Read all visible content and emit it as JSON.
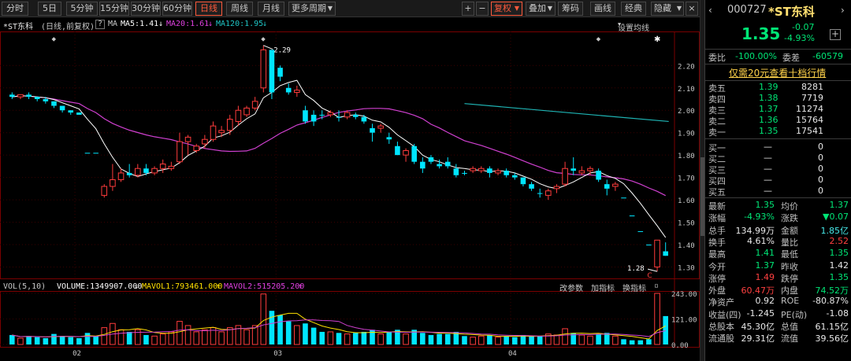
{
  "toolbar": {
    "tabs": [
      "分时",
      "5日",
      "5分钟",
      "15分钟",
      "30分钟",
      "60分钟",
      "日线",
      "周线",
      "月线",
      "更多周期"
    ],
    "active_tab": "日线",
    "plus": "+",
    "minus": "−",
    "fuquan": "复权",
    "diejia": "叠加",
    "chouma": "筹码",
    "huaxian": "画线",
    "jingdian": "经典",
    "yincang": "隐藏",
    "close": "×"
  },
  "infobar": {
    "name": "*ST东科",
    "mode": "(日线,前复权)",
    "help": "?",
    "ma5": "MA5:1.41",
    "ma20": "MA20:1.61",
    "ma120": "MA120:1.95",
    "arrow_down": "↓",
    "settings": "设置均线"
  },
  "volinfo": {
    "label": "VOL(5,10)",
    "volume": "VOLUME:1349907.000",
    "mavol1": "MAVOL1:793461.000",
    "mavol2": "MAVOL2:515205.200",
    "arrow_down": "↓",
    "arrow_up": "↑",
    "btn1": "改参数",
    "btn2": "加指标",
    "btn3": "换指标"
  },
  "right": {
    "code": "000727",
    "name": "*ST东科",
    "price": "1.35",
    "change": "-0.07",
    "change_pct": "-4.93%",
    "weibi_label": "委比",
    "weibi": "-100.00%",
    "weicha_label": "委差",
    "weicha": "-60579",
    "link": "仅需20元查看十档行情",
    "sell": [
      {
        "label": "卖五",
        "price": "1.39",
        "vol": "8281"
      },
      {
        "label": "卖四",
        "price": "1.38",
        "vol": "7719"
      },
      {
        "label": "卖三",
        "price": "1.37",
        "vol": "11274"
      },
      {
        "label": "卖二",
        "price": "1.36",
        "vol": "15764"
      },
      {
        "label": "卖一",
        "price": "1.35",
        "vol": "17541"
      }
    ],
    "buy": [
      {
        "label": "买一",
        "price": "—",
        "vol": "0"
      },
      {
        "label": "买二",
        "price": "—",
        "vol": "0"
      },
      {
        "label": "买三",
        "price": "—",
        "vol": "0"
      },
      {
        "label": "买四",
        "price": "—",
        "vol": "0"
      },
      {
        "label": "买五",
        "price": "—",
        "vol": "0"
      }
    ],
    "stats": [
      {
        "l1": "最新",
        "v1": "1.35",
        "c1": "grn",
        "l2": "均价",
        "v2": "1.37",
        "c2": "grn"
      },
      {
        "l1": "涨幅",
        "v1": "-4.93%",
        "c1": "grn",
        "l2": "涨跌",
        "v2": "▼0.07",
        "c2": "grn"
      },
      {
        "l1": "总手",
        "v1": "134.99万",
        "c1": "wht",
        "l2": "金额",
        "v2": "1.85亿",
        "c2": "cyn"
      },
      {
        "l1": "换手",
        "v1": "4.61%",
        "c1": "wht",
        "l2": "量比",
        "v2": "2.52",
        "c2": "red"
      },
      {
        "l1": "最高",
        "v1": "1.41",
        "c1": "grn",
        "l2": "最低",
        "v2": "1.35",
        "c2": "grn"
      },
      {
        "l1": "今开",
        "v1": "1.37",
        "c1": "grn",
        "l2": "昨收",
        "v2": "1.42",
        "c2": "wht"
      },
      {
        "l1": "涨停",
        "v1": "1.49",
        "c1": "red",
        "l2": "跌停",
        "v2": "1.35",
        "c2": "grn"
      },
      {
        "l1": "外盘",
        "v1": "60.47万",
        "c1": "red",
        "l2": "内盘",
        "v2": "74.52万",
        "c2": "grn"
      },
      {
        "l1": "净资产",
        "v1": "0.92",
        "c1": "wht",
        "l2": "ROE",
        "v2": "-80.87%",
        "c2": "wht"
      },
      {
        "l1": "收益(四)",
        "v1": "-1.245",
        "c1": "wht",
        "l2": "PE(动)",
        "v2": "-1.08",
        "c2": "wht"
      },
      {
        "l1": "总股本",
        "v1": "45.30亿",
        "c1": "wht",
        "l2": "总值",
        "v2": "61.15亿",
        "c2": "wht"
      },
      {
        "l1": "流通股",
        "v1": "29.31亿",
        "c1": "wht",
        "l2": "流值",
        "v2": "39.56亿",
        "c2": "wht"
      }
    ]
  },
  "chart_data": {
    "type": "candlestick",
    "price_ticks": [
      "2.20",
      "2.10",
      "2.00",
      "1.90",
      "1.80",
      "1.70",
      "1.60",
      "1.50",
      "1.40",
      "1.30"
    ],
    "vol_ticks": [
      "243.00",
      "121.00",
      "0.00"
    ],
    "x_labels": [
      "02",
      "03",
      "04"
    ],
    "annotations": {
      "high": "2.29",
      "low": "1.28",
      "marker": "⬥",
      "star": "✱",
      "c_label": "C"
    },
    "colors": {
      "up": "#ff3c3c",
      "down": "#00e5ff",
      "ma5": "#ffffff",
      "ma20": "#d040d0",
      "ma120": "#1fb5b5",
      "mavol1": "#ffe000",
      "mavol2": "#d040d0",
      "grid": "#2a0000"
    },
    "candles": [
      [
        2.07,
        2.08,
        2.05,
        2.06,
        0.45
      ],
      [
        2.06,
        2.07,
        2.05,
        2.07,
        0.3
      ],
      [
        2.07,
        2.08,
        2.05,
        2.06,
        0.4
      ],
      [
        2.06,
        2.06,
        2.04,
        2.05,
        0.35
      ],
      [
        2.05,
        2.06,
        2.03,
        2.04,
        0.3
      ],
      [
        2.04,
        2.04,
        2.01,
        2.02,
        0.5
      ],
      [
        2.02,
        2.02,
        1.99,
        2.0,
        0.4
      ],
      [
        2.0,
        2.0,
        1.98,
        1.99,
        0.35
      ],
      [
        1.99,
        1.99,
        1.98,
        1.98,
        0.3
      ],
      [
        1.81,
        1.81,
        1.81,
        1.81,
        0.55
      ],
      [
        1.81,
        1.81,
        1.81,
        1.81,
        0.4
      ],
      [
        1.62,
        1.67,
        1.61,
        1.66,
        0.8
      ],
      [
        1.66,
        1.76,
        1.64,
        1.69,
        1.0
      ],
      [
        1.69,
        1.74,
        1.68,
        1.72,
        0.7
      ],
      [
        1.72,
        1.76,
        1.7,
        1.71,
        0.6
      ],
      [
        1.71,
        1.76,
        1.7,
        1.74,
        0.7
      ],
      [
        1.74,
        1.76,
        1.71,
        1.72,
        0.45
      ],
      [
        1.72,
        1.75,
        1.71,
        1.74,
        0.4
      ],
      [
        1.74,
        1.78,
        1.72,
        1.76,
        0.5
      ],
      [
        1.74,
        1.77,
        1.73,
        1.75,
        0.6
      ],
      [
        1.77,
        1.9,
        1.76,
        1.86,
        1.1
      ],
      [
        1.86,
        1.89,
        1.8,
        1.88,
        0.9
      ],
      [
        1.82,
        1.85,
        1.81,
        1.84,
        0.6
      ],
      [
        1.85,
        1.89,
        1.83,
        1.87,
        0.7
      ],
      [
        1.87,
        1.95,
        1.86,
        1.93,
        0.8
      ],
      [
        1.9,
        1.93,
        1.88,
        1.91,
        0.6
      ],
      [
        1.91,
        1.98,
        1.89,
        1.96,
        0.8
      ],
      [
        1.95,
        2.02,
        1.93,
        2.0,
        0.9
      ],
      [
        1.98,
        2.02,
        1.97,
        2.01,
        0.7
      ],
      [
        2.01,
        2.06,
        2.0,
        2.04,
        0.9
      ],
      [
        2.1,
        2.29,
        2.08,
        2.27,
        2.4
      ],
      [
        2.27,
        2.27,
        2.05,
        2.08,
        1.6
      ],
      [
        2.19,
        2.2,
        2.13,
        2.15,
        1.4
      ],
      [
        2.1,
        2.12,
        2.07,
        2.08,
        1.1
      ],
      [
        2.08,
        2.11,
        2.06,
        2.09,
        0.9
      ],
      [
        2.0,
        2.02,
        1.94,
        1.95,
        1.0
      ],
      [
        1.98,
        2.0,
        1.93,
        1.95,
        0.8
      ],
      [
        1.98,
        2.0,
        1.96,
        1.98,
        0.6
      ],
      [
        1.98,
        2.0,
        1.97,
        1.99,
        0.6
      ],
      [
        1.97,
        2.0,
        1.95,
        1.97,
        0.55
      ],
      [
        1.97,
        2.0,
        1.96,
        1.99,
        0.5
      ],
      [
        1.98,
        1.99,
        1.96,
        1.97,
        0.55
      ],
      [
        1.97,
        1.98,
        1.94,
        1.95,
        0.6
      ],
      [
        1.92,
        1.94,
        1.86,
        1.9,
        0.7
      ],
      [
        1.92,
        1.94,
        1.9,
        1.93,
        0.5
      ],
      [
        1.88,
        1.9,
        1.85,
        1.87,
        0.6
      ],
      [
        1.84,
        1.86,
        1.8,
        1.8,
        0.7
      ],
      [
        1.8,
        1.83,
        1.77,
        1.82,
        0.5
      ],
      [
        1.84,
        1.85,
        1.76,
        1.77,
        0.7
      ],
      [
        1.77,
        1.79,
        1.72,
        1.74,
        0.55
      ],
      [
        1.79,
        1.8,
        1.76,
        1.77,
        0.45
      ],
      [
        1.76,
        1.78,
        1.74,
        1.75,
        0.5
      ],
      [
        1.77,
        1.79,
        1.74,
        1.75,
        0.5
      ],
      [
        1.74,
        1.76,
        1.7,
        1.71,
        0.6
      ],
      [
        1.72,
        1.73,
        1.71,
        1.72,
        0.4
      ],
      [
        1.73,
        1.75,
        1.72,
        1.74,
        0.35
      ],
      [
        1.73,
        1.75,
        1.72,
        1.74,
        0.4
      ],
      [
        1.74,
        1.75,
        1.7,
        1.72,
        0.45
      ],
      [
        1.72,
        1.74,
        1.71,
        1.73,
        0.35
      ],
      [
        1.73,
        1.74,
        1.7,
        1.71,
        0.4
      ],
      [
        1.71,
        1.72,
        1.69,
        1.7,
        0.35
      ],
      [
        1.7,
        1.7,
        1.66,
        1.67,
        0.45
      ],
      [
        1.67,
        1.68,
        1.64,
        1.65,
        0.4
      ],
      [
        1.63,
        1.65,
        1.61,
        1.63,
        0.4
      ],
      [
        1.62,
        1.65,
        1.6,
        1.64,
        0.5
      ],
      [
        1.65,
        1.67,
        1.63,
        1.66,
        0.45
      ],
      [
        1.67,
        1.77,
        1.66,
        1.74,
        0.75
      ],
      [
        1.74,
        1.79,
        1.71,
        1.73,
        0.55
      ],
      [
        1.72,
        1.75,
        1.71,
        1.73,
        0.45
      ],
      [
        1.73,
        1.75,
        1.71,
        1.74,
        0.4
      ],
      [
        1.73,
        1.74,
        1.68,
        1.69,
        0.5
      ],
      [
        1.67,
        1.69,
        1.62,
        1.65,
        0.55
      ],
      [
        1.66,
        1.68,
        1.64,
        1.67,
        0.4
      ],
      [
        1.61,
        1.61,
        1.61,
        1.61,
        0.25
      ],
      [
        1.53,
        1.53,
        1.53,
        1.53,
        0.2
      ],
      [
        1.46,
        1.46,
        1.46,
        1.46,
        0.2
      ],
      [
        1.4,
        1.4,
        1.4,
        1.4,
        0.25
      ],
      [
        1.3,
        1.42,
        1.28,
        1.42,
        2.43
      ],
      [
        1.37,
        1.41,
        1.35,
        1.35,
        1.35
      ]
    ],
    "ma120": {
      "x_start": 54,
      "y_start": 2.03,
      "y_end": 1.95
    },
    "y_range": [
      1.27,
      2.31
    ],
    "vol_max": 2.43
  }
}
